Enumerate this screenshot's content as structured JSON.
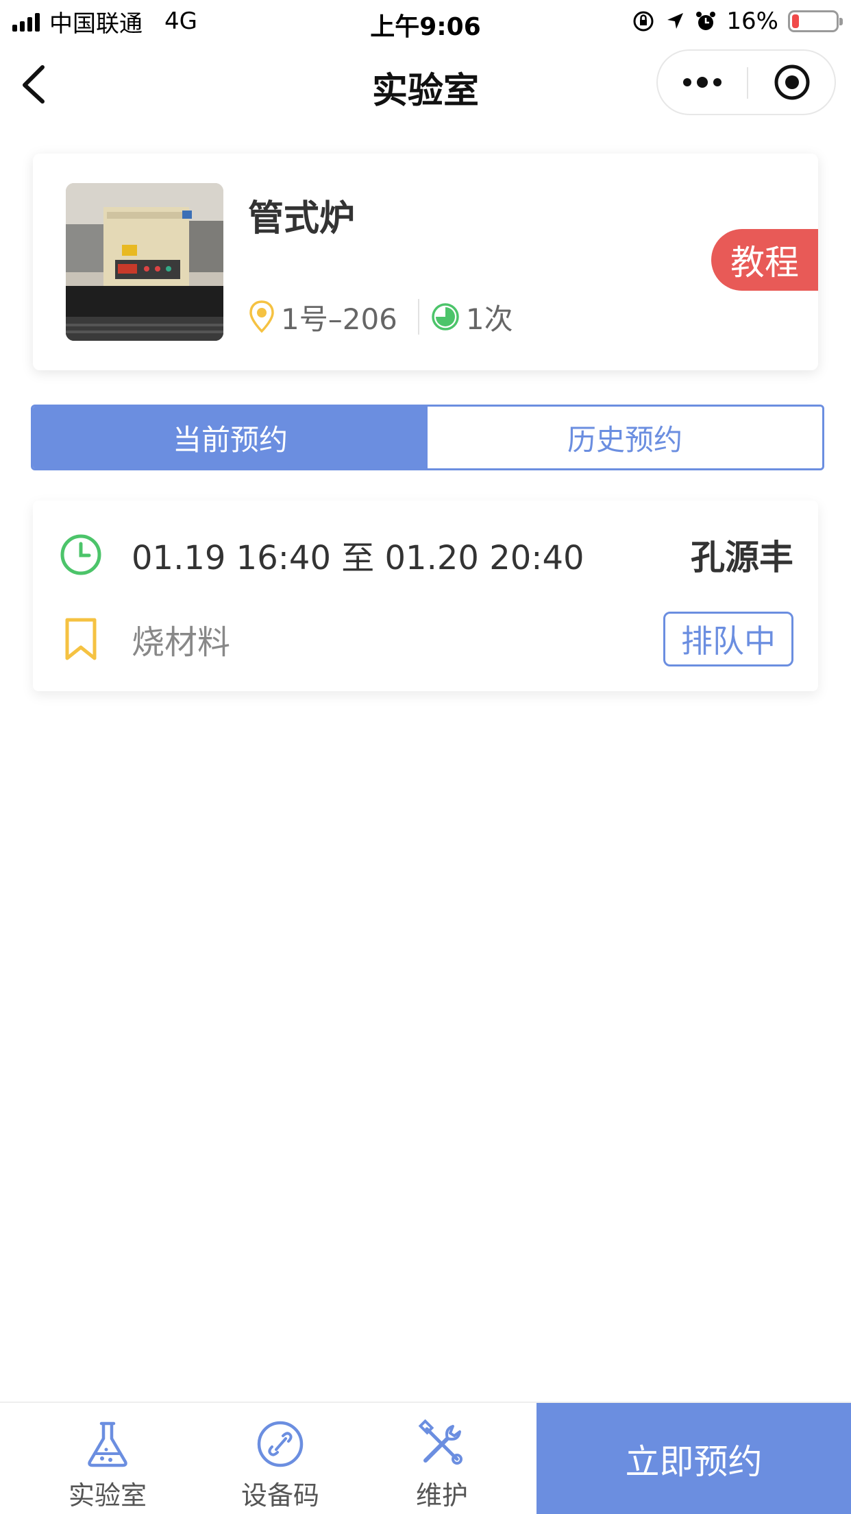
{
  "status_bar": {
    "carrier": "中国联通",
    "network": "4G",
    "time": "上午9:06",
    "battery_percent": "16%",
    "battery_level": 0.16
  },
  "nav": {
    "title": "实验室",
    "back_icon": "chevron-left-icon",
    "more_icon": "more-dots-icon",
    "close_icon": "target-circle-icon"
  },
  "device": {
    "name": "管式炉",
    "location": "1号–206",
    "usage_count": "1次",
    "tutorial_label": "教程",
    "location_icon": "location-pin-icon",
    "count_icon": "pie-chart-icon"
  },
  "tabs": [
    {
      "label": "当前预约",
      "active": true
    },
    {
      "label": "历史预约",
      "active": false
    }
  ],
  "reservation": {
    "time_range": "01.19 16:40 至 01.20 20:40",
    "user": "孔源丰",
    "purpose": "烧材料",
    "status": "排队中",
    "clock_icon": "clock-icon",
    "purpose_icon": "bookmark-icon"
  },
  "bottom_bar": {
    "items": [
      {
        "label": "实验室",
        "icon": "flask-icon"
      },
      {
        "label": "设备码",
        "icon": "link-circle-icon"
      },
      {
        "label": "维护",
        "icon": "tools-icon"
      }
    ],
    "reserve_label": "立即预约"
  },
  "colors": {
    "primary": "#6b8ee0",
    "tutorial_red": "#e85a57",
    "location_yellow": "#f5c242",
    "count_green": "#4cc46a",
    "clock_green": "#4cc46a",
    "bookmark_yellow": "#f5c242",
    "battery_red": "#f04a4a"
  }
}
